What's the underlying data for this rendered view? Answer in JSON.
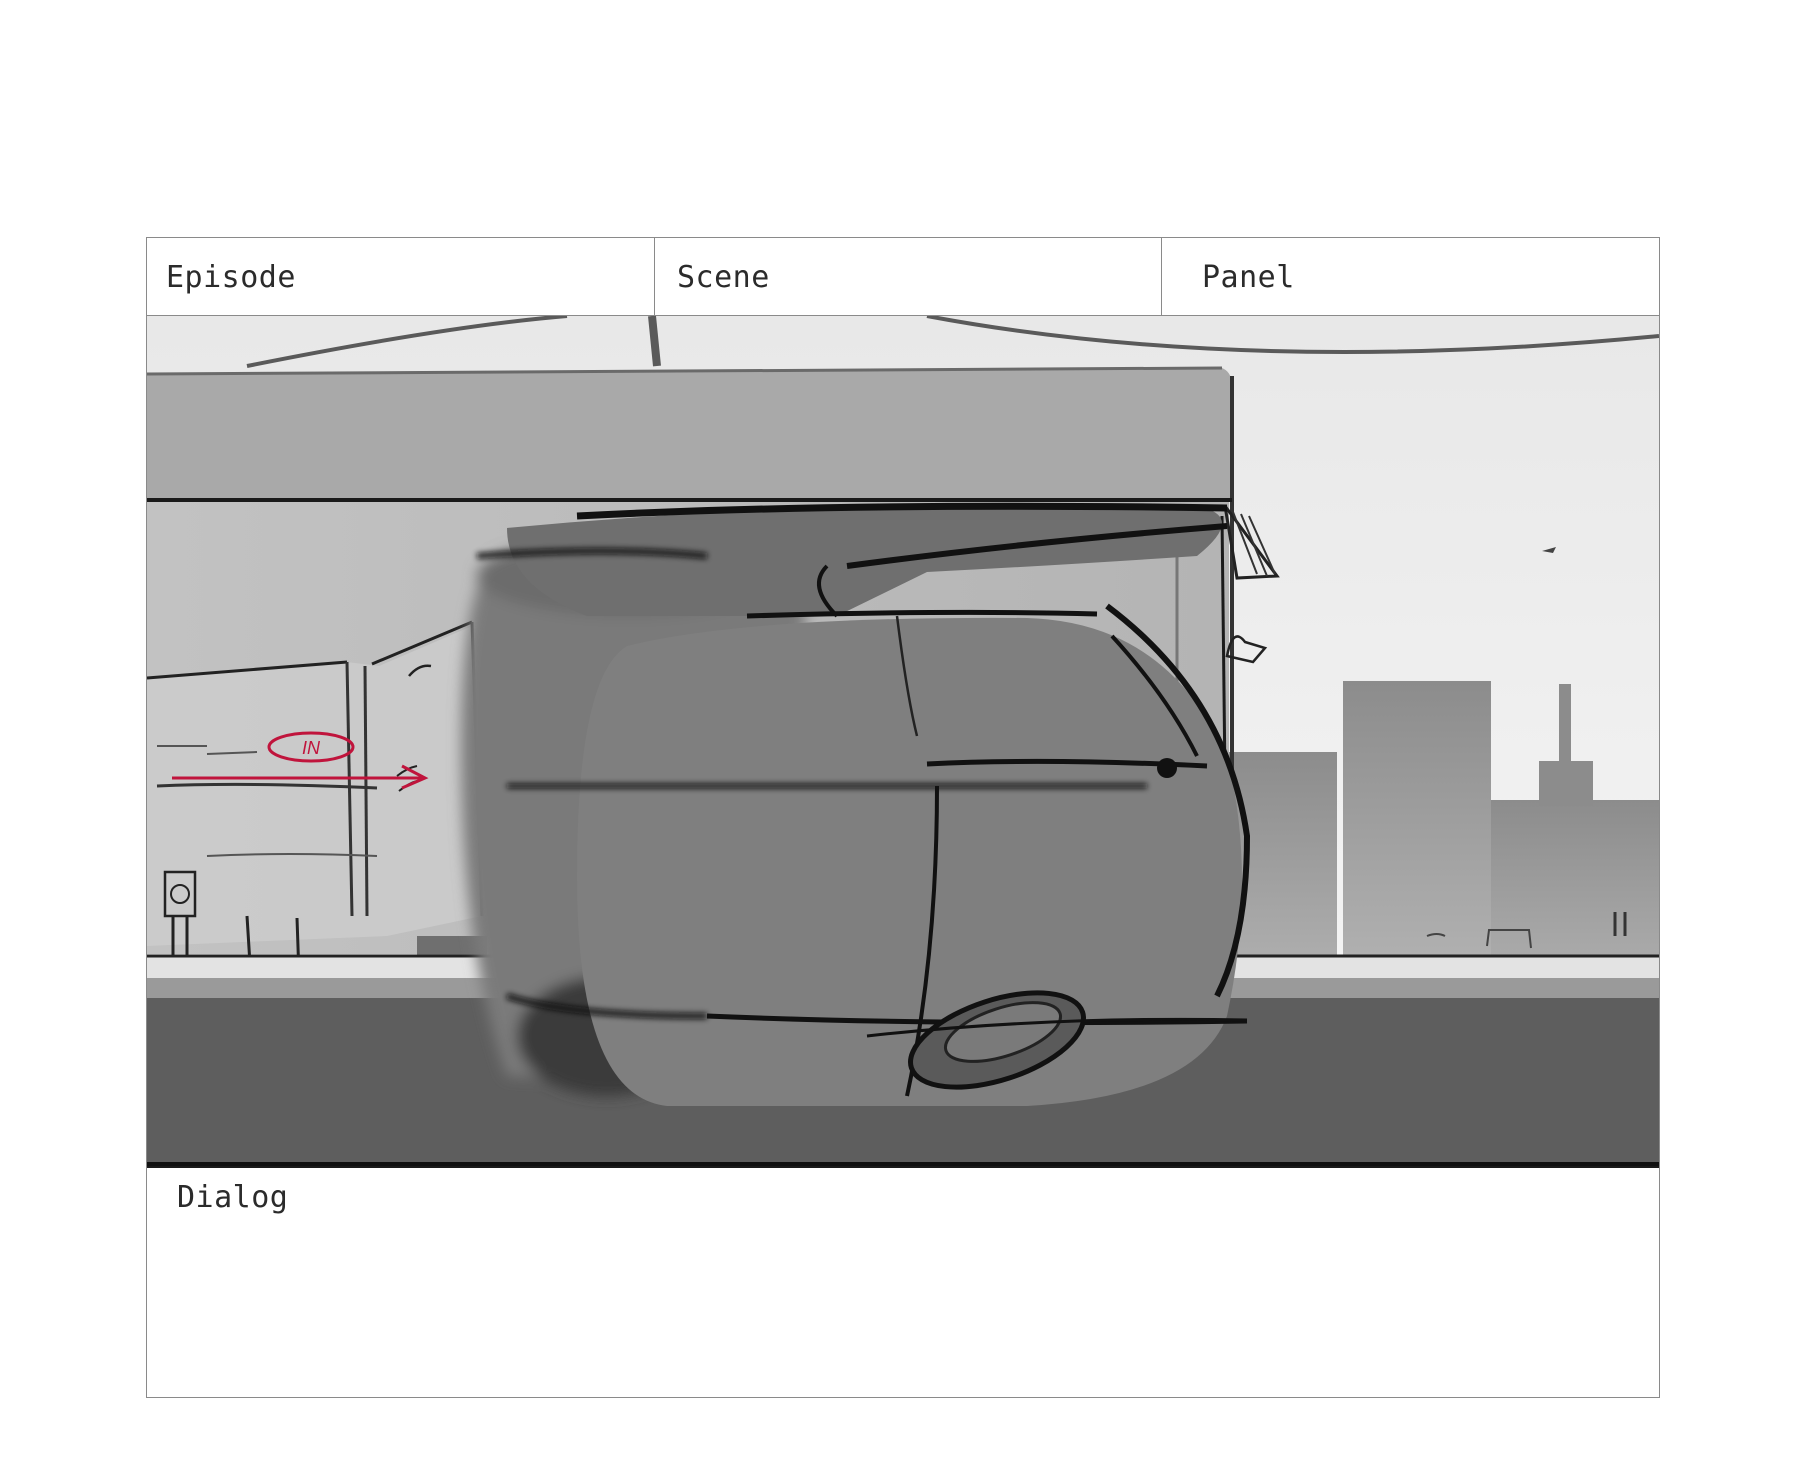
{
  "storyboard": {
    "episode_label": "Episode",
    "scene_label": "Scene",
    "panel_label": "Panel",
    "dialog_label": "Dialog",
    "annotation_in": "IN",
    "annotation_color": "#c0143c"
  }
}
